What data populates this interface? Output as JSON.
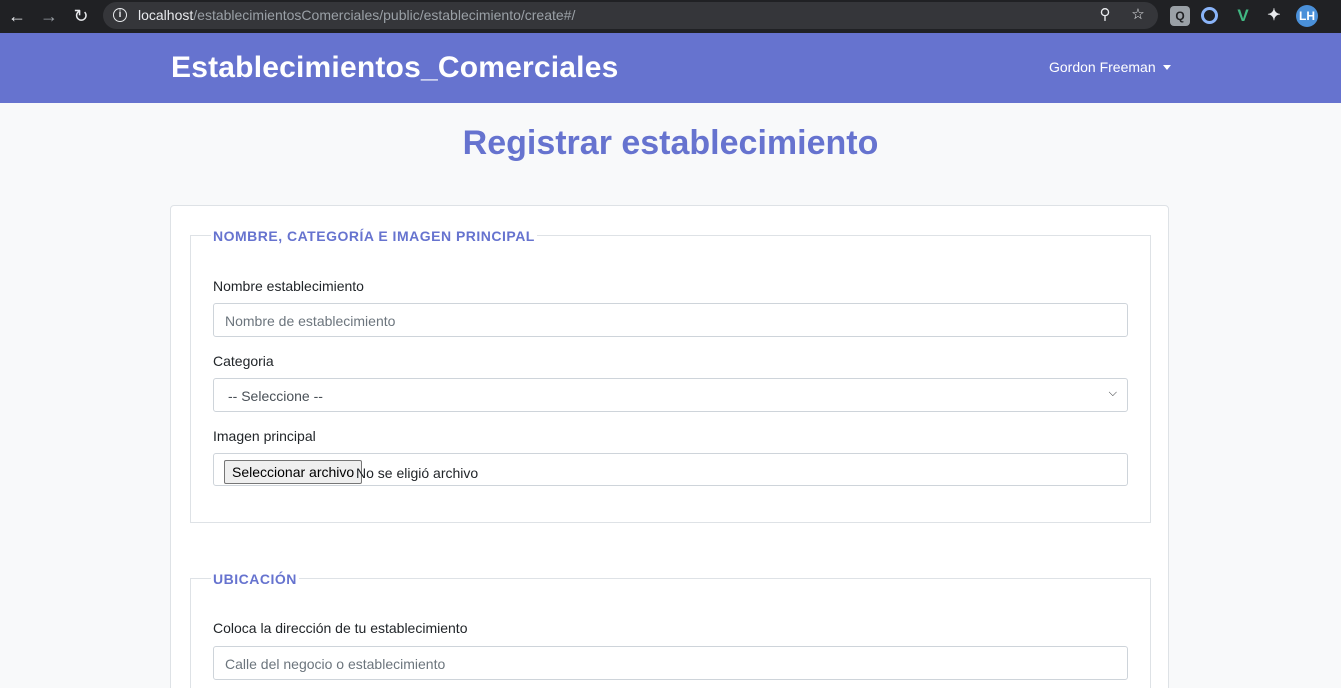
{
  "browser": {
    "url_host": "localhost",
    "url_path": "/establecimientosComerciales/public/establecimiento/create#/",
    "profile_initials": "LH"
  },
  "navbar": {
    "brand": "Establecimientos_Comerciales",
    "user_name": "Gordon Freeman",
    "background_color": "#6673cf"
  },
  "page": {
    "title": "Registrar establecimiento"
  },
  "section1": {
    "legend": "Nombre, Categoría e imagen principal",
    "name_label": "Nombre establecimiento",
    "name_placeholder": "Nombre de establecimiento",
    "category_label": "Categoria",
    "category_selected": "-- Seleccione --",
    "image_label": "Imagen principal",
    "file_button": "Seleccionar archivo",
    "file_status": "No se eligió archivo"
  },
  "section2": {
    "legend": "Ubicación",
    "address_label": "Coloca la dirección de tu establecimiento",
    "address_placeholder": "Calle del negocio o establecimiento"
  }
}
